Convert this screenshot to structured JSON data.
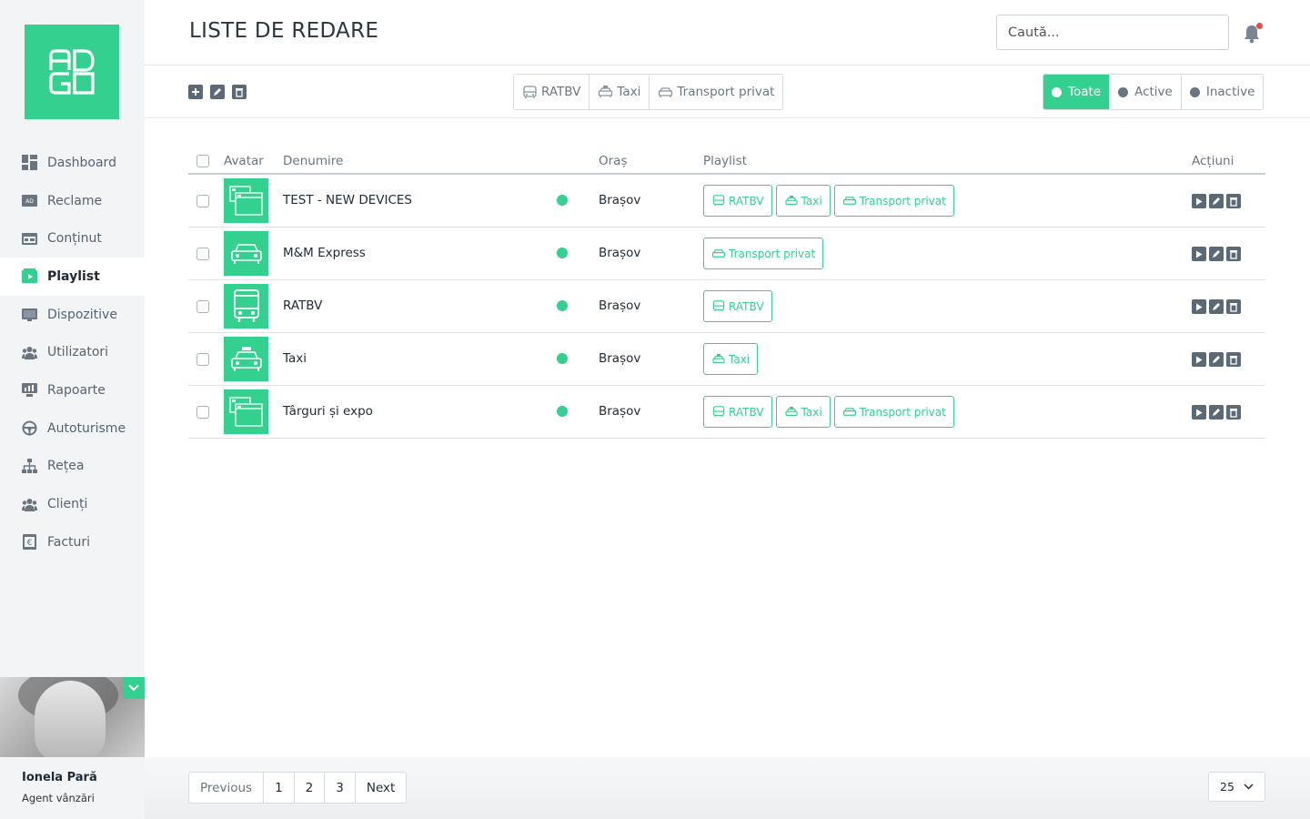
{
  "sidebar": {
    "logo_text": "ADGO",
    "items": [
      {
        "label": "Dashboard",
        "icon": "dashboard-icon"
      },
      {
        "label": "Reclame",
        "icon": "ad-icon"
      },
      {
        "label": "Conținut",
        "icon": "content-icon"
      },
      {
        "label": "Playlist",
        "icon": "playlist-icon",
        "active": true
      },
      {
        "label": "Dispozitive",
        "icon": "device-icon"
      },
      {
        "label": "Utilizatori",
        "icon": "users-icon"
      },
      {
        "label": "Rapoarte",
        "icon": "reports-icon"
      },
      {
        "label": "Autoturisme",
        "icon": "steering-wheel-icon"
      },
      {
        "label": "Rețea",
        "icon": "network-icon"
      },
      {
        "label": "Clienți",
        "icon": "clients-icon"
      },
      {
        "label": "Facturi",
        "icon": "invoice-icon"
      }
    ],
    "user": {
      "name": "Ionela Pară",
      "role": "Agent vânzări"
    }
  },
  "header": {
    "title": "LISTE DE REDARE",
    "search_placeholder": "Caută..."
  },
  "toolbar": {
    "filters": [
      "RATBV",
      "Taxi",
      "Transport privat"
    ],
    "statuses": [
      "Toate",
      "Active",
      "Inactive"
    ],
    "active_status": "Toate"
  },
  "table": {
    "columns": {
      "avatar": "Avatar",
      "name": "Denumire",
      "city": "Oraș",
      "playlist": "Playlist",
      "actions": "Acțiuni"
    },
    "rows": [
      {
        "name": "TEST - NEW DEVICES",
        "city": "Brașov",
        "avatar": "screens-icon",
        "tags": [
          "RATBV",
          "Taxi",
          "Transport privat"
        ]
      },
      {
        "name": "M&M Express",
        "city": "Brașov",
        "avatar": "car-icon",
        "tags": [
          "Transport privat"
        ]
      },
      {
        "name": "RATBV",
        "city": "Brașov",
        "avatar": "bus-icon",
        "tags": [
          "RATBV"
        ]
      },
      {
        "name": "Taxi",
        "city": "Brașov",
        "avatar": "taxi-icon",
        "tags": [
          "Taxi"
        ]
      },
      {
        "name": "Târguri și expo",
        "city": "Brașov",
        "avatar": "screens-icon",
        "tags": [
          "RATBV",
          "Taxi",
          "Transport privat"
        ]
      }
    ]
  },
  "pagination": {
    "previous": "Previous",
    "pages": [
      "1",
      "2",
      "3"
    ],
    "next": "Next",
    "per_page": "25"
  },
  "colors": {
    "accent": "#33d08f",
    "alert": "#e64b4b",
    "icon_gray": "#5b6977"
  }
}
